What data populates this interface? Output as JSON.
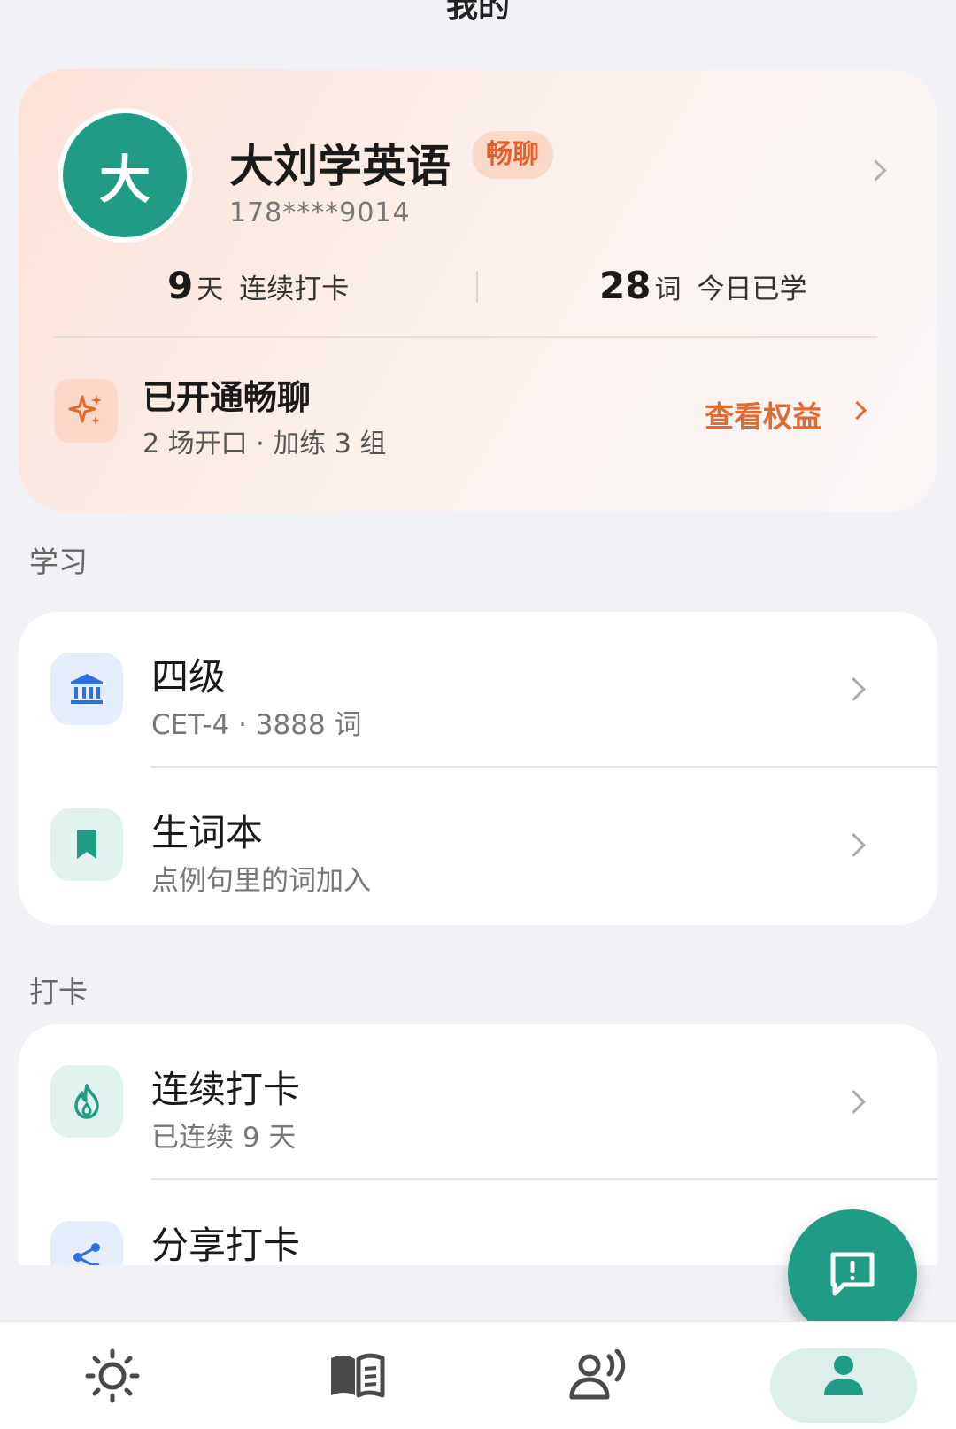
{
  "header": {
    "title": "我的"
  },
  "profile": {
    "avatar_text": "大",
    "name": "大刘学英语",
    "badge": "畅聊",
    "phone": "178****9014",
    "stats": {
      "streak_value": "9",
      "streak_unit": "天",
      "streak_label": "连续打卡",
      "learned_value": "28",
      "learned_unit": "词",
      "learned_label": "今日已学"
    },
    "vip": {
      "title": "已开通畅聊",
      "subtitle": "2 场开口 · 加练 3 组",
      "link": "查看权益"
    }
  },
  "sections": {
    "study": {
      "label": "学习",
      "items": [
        {
          "title": "四级",
          "subtitle": "CET-4 · 3888 词",
          "icon": "bank-icon"
        },
        {
          "title": "生词本",
          "subtitle": "点例句里的词加入",
          "icon": "bookmark-icon"
        }
      ]
    },
    "checkin": {
      "label": "打卡",
      "items": [
        {
          "title": "连续打卡",
          "subtitle": "已连续 9 天",
          "icon": "flame-icon"
        },
        {
          "title": "分享打卡",
          "subtitle": "",
          "icon": "share-icon"
        }
      ]
    }
  },
  "nav": {
    "items": [
      {
        "icon": "sun-icon",
        "active": false
      },
      {
        "icon": "book-icon",
        "active": false
      },
      {
        "icon": "speaking-icon",
        "active": false
      },
      {
        "icon": "person-icon",
        "active": true
      }
    ]
  },
  "colors": {
    "accent": "#1f9c83",
    "vip_orange": "#e06a30",
    "background": "#f1f1f6"
  }
}
